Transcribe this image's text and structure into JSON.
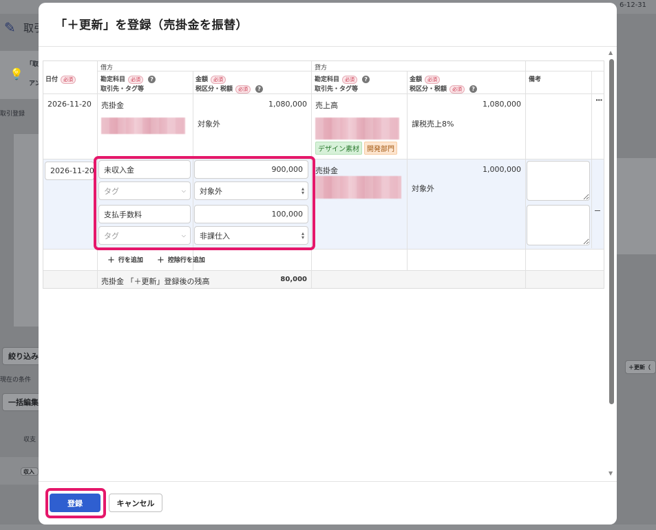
{
  "background": {
    "date_fragment": "6-12-31",
    "page_fragment": "取引",
    "bulb_line1": "「取",
    "bulb_line2": "アン",
    "register_fragment": "取引登録",
    "filter_button": "絞り込み",
    "current_conditions": "現在の条件",
    "bulk_edit": "一括編集",
    "col_income_expense": "収支",
    "income_badge": "収入",
    "update_fragment": "＋更新（"
  },
  "modal": {
    "title": "「＋更新」を登録（売掛金を振替）",
    "headers": {
      "debit": "借方",
      "credit": "貸方",
      "date": "日付",
      "account": "勘定科目",
      "partner_tag": "取引先・タグ等",
      "amount": "金額",
      "tax": "税区分・税額",
      "memo": "備考",
      "required": "必須"
    },
    "rows": [
      {
        "date": "2026-11-20",
        "debit_account": "売掛金",
        "debit_amount": "1,080,000",
        "debit_tax": "対象外",
        "credit_account": "売上高",
        "credit_amount": "1,080,000",
        "credit_tax": "課税売上8%",
        "credit_tags": [
          "デザイン素材",
          "開発部門"
        ]
      }
    ],
    "edit_row": {
      "date": "2026-11-20",
      "lines": [
        {
          "account": "未収入金",
          "amount": "900,000",
          "tag_placeholder": "タグ",
          "tax": "対象外"
        },
        {
          "account": "支払手数料",
          "amount": "100,000",
          "tag_placeholder": "タグ",
          "tax": "非課仕入"
        }
      ],
      "credit_account": "売掛金",
      "credit_amount": "1,000,000",
      "credit_tax": "対象外"
    },
    "actions": {
      "add_row": "行を追加",
      "add_deduction_row": "控除行を追加"
    },
    "balance": {
      "label": "売掛金 「＋更新」登録後の残高",
      "value": "80,000"
    },
    "buttons": {
      "register": "登録",
      "cancel": "キャンセル"
    }
  },
  "colors": {
    "primary": "#2f5fd0",
    "highlight": "#e5176a",
    "row_highlight": "#eef3fc"
  }
}
